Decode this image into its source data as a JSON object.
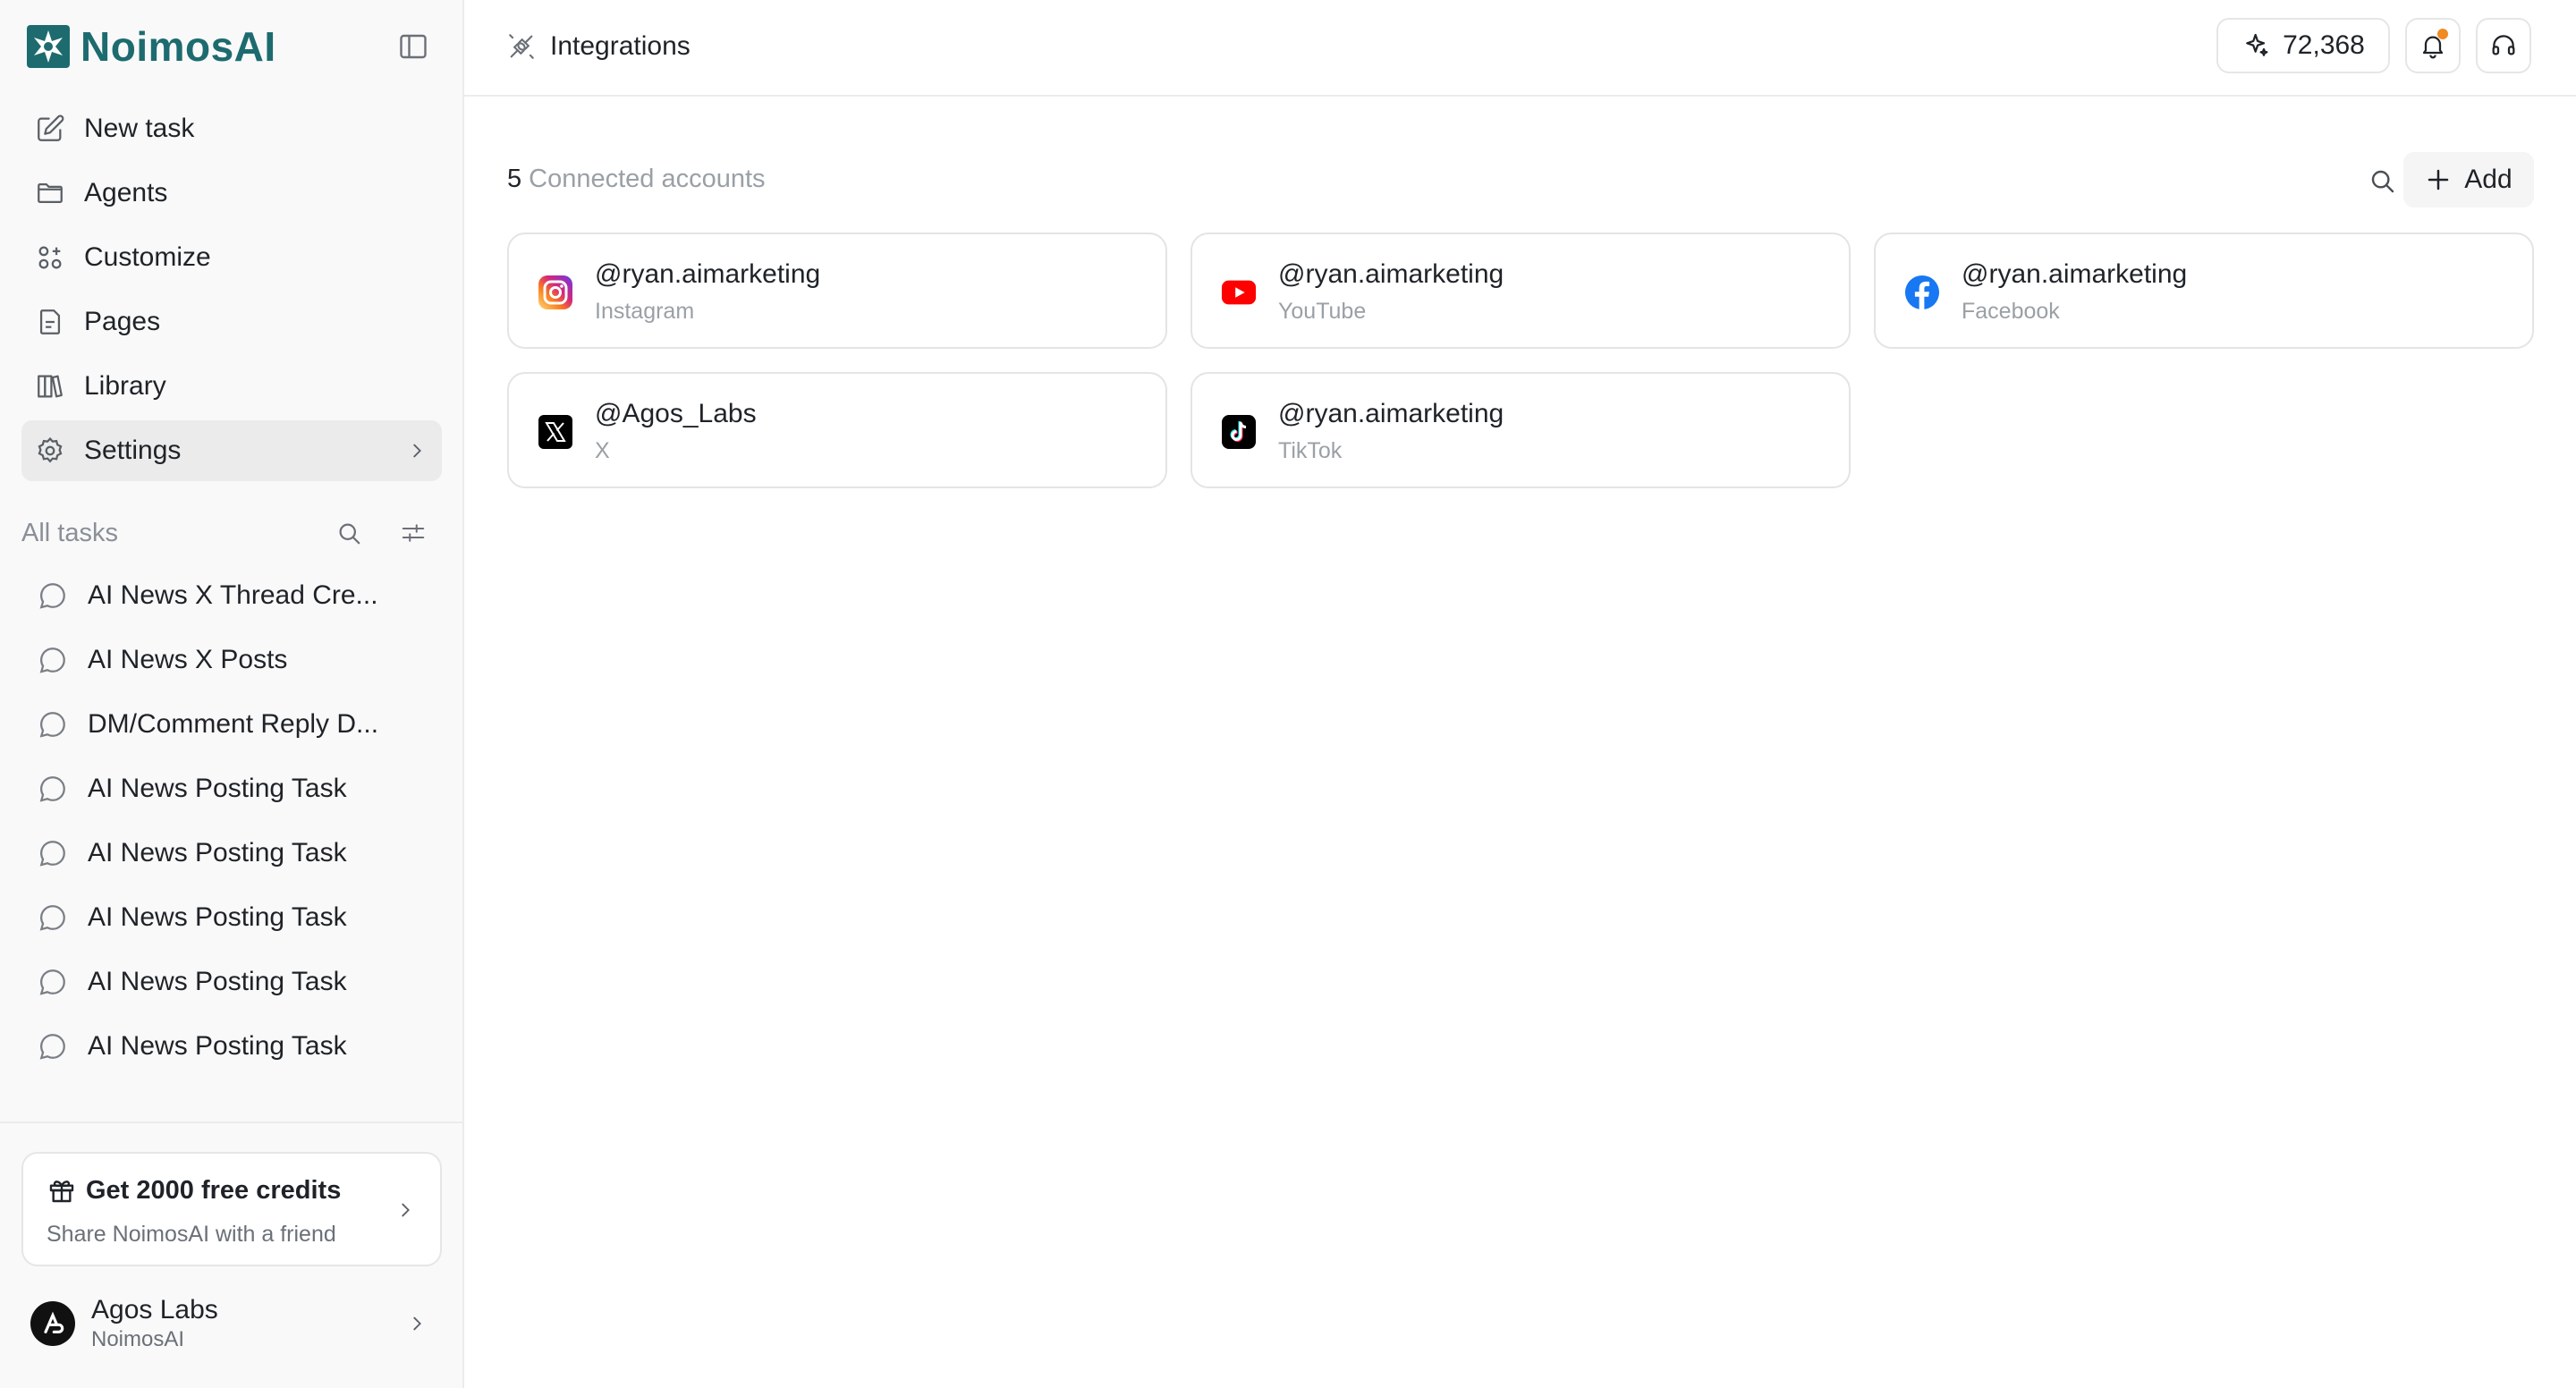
{
  "brand": {
    "name": "NoimosAI"
  },
  "colors": {
    "brand": "#1d6b6f",
    "notification": "#f08a24",
    "active_nav_bg": "#ebebeb"
  },
  "nav": [
    {
      "id": "new-task",
      "label": "New task",
      "icon": "edit-icon"
    },
    {
      "id": "agents",
      "label": "Agents",
      "icon": "folder-icon"
    },
    {
      "id": "customize",
      "label": "Customize",
      "icon": "grid-icon"
    },
    {
      "id": "pages",
      "label": "Pages",
      "icon": "document-icon"
    },
    {
      "id": "library",
      "label": "Library",
      "icon": "library-icon"
    },
    {
      "id": "settings",
      "label": "Settings",
      "icon": "gear-icon",
      "active": true
    }
  ],
  "tasks_section": {
    "label": "All tasks"
  },
  "tasks": [
    "AI News X Thread Cre...",
    "AI News X Posts",
    "DM/Comment Reply D...",
    "AI News Posting Task",
    "AI News Posting Task",
    "AI News Posting Task",
    "AI News Posting Task",
    "AI News Posting Task"
  ],
  "promo": {
    "title": "Get 2000 free credits",
    "subtitle": "Share NoimosAI with a friend"
  },
  "user": {
    "name": "Agos Labs",
    "org": "NoimosAI"
  },
  "header": {
    "title": "Integrations",
    "credits": "72,368"
  },
  "accounts": {
    "count": "5",
    "count_label": "Connected accounts",
    "add_label": "Add",
    "items": [
      {
        "handle": "@ryan.aimarketing",
        "platform": "Instagram",
        "icon": "instagram-icon"
      },
      {
        "handle": "@ryan.aimarketing",
        "platform": "YouTube",
        "icon": "youtube-icon"
      },
      {
        "handle": "@ryan.aimarketing",
        "platform": "Facebook",
        "icon": "facebook-icon"
      },
      {
        "handle": "@Agos_Labs",
        "platform": "X",
        "icon": "x-icon"
      },
      {
        "handle": "@ryan.aimarketing",
        "platform": "TikTok",
        "icon": "tiktok-icon"
      }
    ]
  }
}
